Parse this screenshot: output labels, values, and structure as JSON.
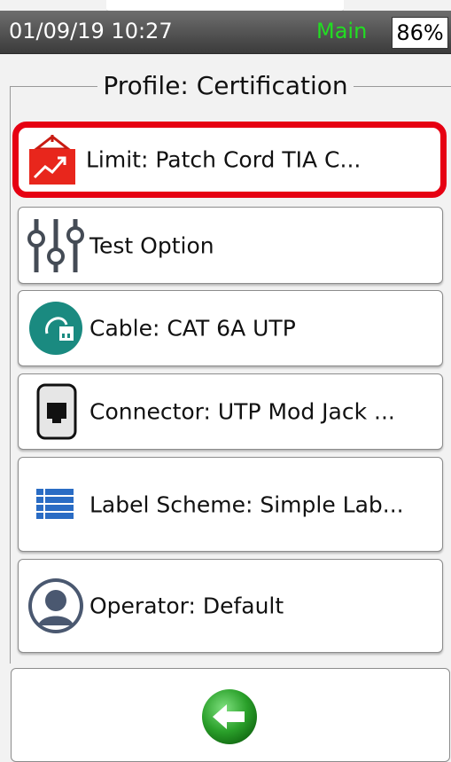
{
  "status_bar": {
    "datetime": "01/09/19 10:27",
    "mode": "Main",
    "battery": "86%",
    "mode_color": "#22dd22"
  },
  "profile": {
    "title": "Profile: Certification",
    "items": [
      {
        "label": "Limit: Patch Cord TIA C...",
        "icon": "limit-chart-icon",
        "selected": true
      },
      {
        "label": "Test Option",
        "icon": "sliders-icon",
        "selected": false
      },
      {
        "label": "Cable: CAT 6A UTP",
        "icon": "cable-icon",
        "selected": false
      },
      {
        "label": "Connector: UTP Mod Jack ...",
        "icon": "connector-jack-icon",
        "selected": false
      },
      {
        "label": "Label Scheme: Simple Lab...",
        "icon": "list-icon",
        "selected": false
      },
      {
        "label": "Operator: Default",
        "icon": "user-icon",
        "selected": false
      }
    ]
  },
  "footer": {
    "back_icon": "back-arrow-icon"
  },
  "colors": {
    "selection": "#e60012",
    "back_button": "#2aa02a",
    "cable_icon": "#1a8a80",
    "limit_icon": "#e8261c",
    "operator_icon": "#4a5870",
    "list_icon": "#2a6cc4"
  }
}
